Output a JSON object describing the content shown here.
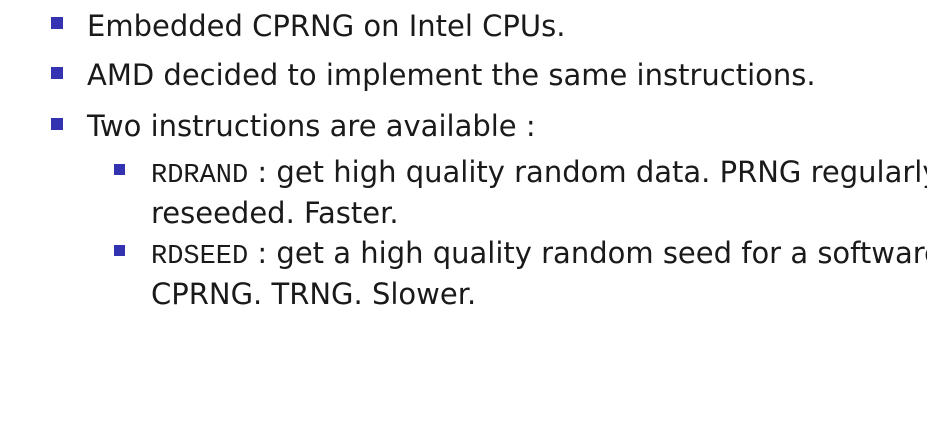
{
  "colors": {
    "bullet": "#3333b2",
    "text": "#1a1a1a",
    "background": "#ffffff"
  },
  "bullets": [
    {
      "text": "Embedded CPRNG on Intel CPUs."
    },
    {
      "text": "AMD decided to implement the same instructions."
    },
    {
      "text": "Two instructions are available :"
    }
  ],
  "sub_bullets": [
    {
      "code": "RDRAND",
      "line1": " : get high quality random data. PRNG regularly",
      "line2": "reseeded. Faster."
    },
    {
      "code": "RDSEED",
      "line1": " : get a high quality random seed for a software",
      "line2": "CPRNG. TRNG. Slower."
    }
  ]
}
